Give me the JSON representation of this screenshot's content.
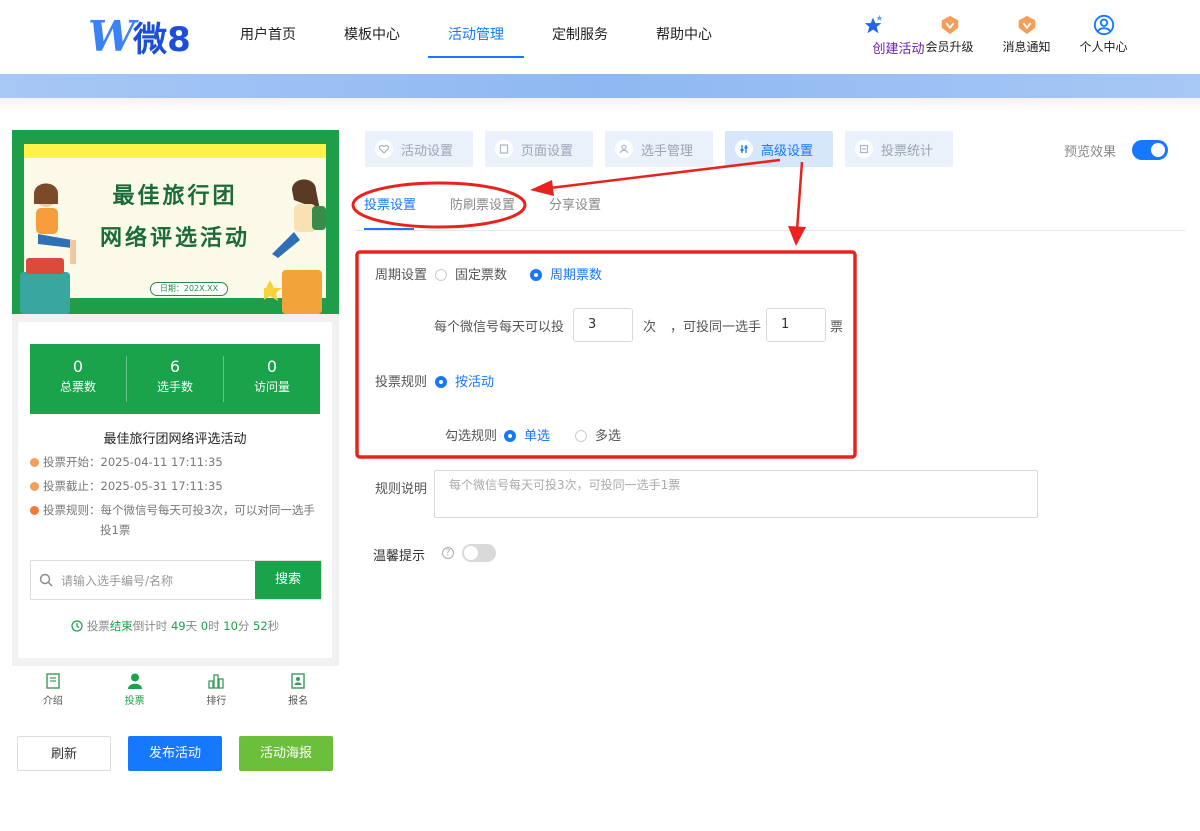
{
  "header": {
    "logo_letter": "W",
    "logo_text": "微8",
    "nav": [
      "用户首页",
      "模板中心",
      "活动管理",
      "定制服务",
      "帮助中心"
    ],
    "nav_active": 2,
    "actions": [
      {
        "label": "创建活动",
        "icon": "stars-icon"
      },
      {
        "label": "会员升级",
        "icon": "member-badge-icon"
      },
      {
        "label": "消息通知",
        "icon": "notification-badge-icon"
      },
      {
        "label": "个人中心",
        "icon": "user-circle-icon"
      }
    ]
  },
  "poster": {
    "title_line1": "最佳旅行团",
    "title_line2": "网络评选活动",
    "date": "日期：202X.XX"
  },
  "stats": [
    {
      "value": "0",
      "label": "总票数"
    },
    {
      "value": "6",
      "label": "选手数"
    },
    {
      "value": "0",
      "label": "访问量"
    }
  ],
  "activity_title": "最佳旅行团网络评选活动",
  "info": {
    "start": "投票开始：2025-04-11 17:11:35",
    "end": "投票截止：2025-05-31 17:11:35",
    "rule_line1": "投票规则：每个微信号每天可投3次，可以对同一选手",
    "rule_line2": "投1票"
  },
  "search": {
    "placeholder": "请输入选手编号/名称",
    "button": "搜索"
  },
  "countdown": {
    "prefix": "投票",
    "status": "结束",
    "mid": "倒计时",
    "days": "49",
    "d": "天",
    "hours": "0",
    "h": "时",
    "minutes": "10",
    "m": "分",
    "seconds": "52",
    "s": "秒"
  },
  "tabbar": [
    {
      "label": "介绍",
      "icon": "document-icon"
    },
    {
      "label": "投票",
      "icon": "person-icon"
    },
    {
      "label": "排行",
      "icon": "bar-chart-icon"
    },
    {
      "label": "报名",
      "icon": "signup-icon"
    }
  ],
  "tabbar_active": 1,
  "bottom_buttons": {
    "refresh": "刷新",
    "publish": "发布活动",
    "poster": "活动海报"
  },
  "steps": [
    {
      "label": "活动设置",
      "icon": "heart-icon"
    },
    {
      "label": "页面设置",
      "icon": "page-icon"
    },
    {
      "label": "选手管理",
      "icon": "user-icon"
    },
    {
      "label": "高级设置",
      "icon": "sliders-icon"
    },
    {
      "label": "投票统计",
      "icon": "chart-icon"
    }
  ],
  "steps_active": 3,
  "preview_label": "预览效果",
  "subtabs": [
    "投票设置",
    "防刷票设置",
    "分享设置"
  ],
  "subtab_active": 0,
  "form": {
    "cycle_label": "周期设置",
    "cycle_fixed": "固定票数",
    "cycle_periodic": "周期票数",
    "per_day_label": "每个微信号每天可以投",
    "per_day_value": "3",
    "times_unit": "次",
    "same_label": "，可投同一选手",
    "same_value": "1",
    "votes_unit": "票",
    "rule_label": "投票规则",
    "rule_by_activity": "按活动",
    "check_label": "勾选规则",
    "check_single": "单选",
    "check_multi": "多选",
    "desc_label": "规则说明",
    "desc_placeholder": "每个微信号每天可投3次，可投同一选手1票",
    "tip_label": "温馨提示",
    "help": "?"
  },
  "colors": {
    "primary": "#1677ff",
    "green": "#1aa34a",
    "annotation": "#e8231e"
  }
}
